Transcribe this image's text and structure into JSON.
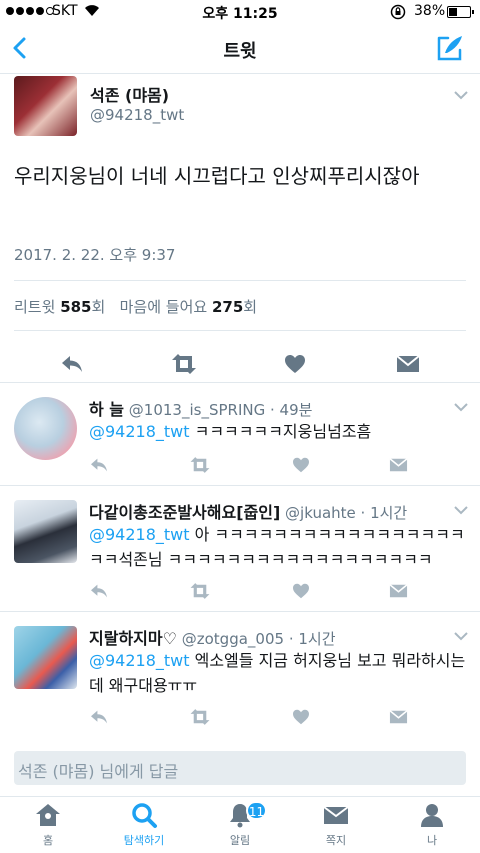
{
  "status": {
    "carrier": "SKT",
    "time": "오후 11:25",
    "battery": "38%",
    "battery_level": 0.38
  },
  "nav": {
    "title": "트윗"
  },
  "tweet": {
    "name": "석존 (먀몸)",
    "handle": "@94218_twt",
    "text": "우리지웅님이 너네 시끄럽다고 인상찌푸리시잖아",
    "timestamp": "2017. 2. 22. 오후 9:37",
    "retweet_label": "리트윗",
    "retweet_count": "585",
    "retweet_unit": "회",
    "like_label": "마음에 들어요",
    "like_count": "275",
    "like_unit": "회"
  },
  "replies": [
    {
      "name": "하 늘",
      "handle": "@1013_is_SPRING",
      "time": "49분",
      "mention": "@94218_twt",
      "text": " ㅋㅋㅋㅋㅋㅋ지웅님넘조흠"
    },
    {
      "name": "다같이총조준발사해요[줍인]",
      "handle": "@jkuahte",
      "time": "1시간",
      "mention": "@94218_twt",
      "text": " 아 ㅋㅋㅋㅋㅋㅋㅋㅋㅋㅋㅋㅋㅋㅋㅋㅋㅋㅋㅋ석존님 ㅋㅋㅋㅋㅋㅋㅋㅋㅋㅋㅋㅋㅋㅋㅋㅋㅋㅋ"
    },
    {
      "name": "지랄하지마♡",
      "handle": "@zotgga_005",
      "time": "1시간",
      "mention": "@94218_twt",
      "text": " 엑소엘들 지금 허지웅님 보고 뭐라하시는데 왜구대용ㅠㅠ"
    }
  ],
  "reply_box": {
    "placeholder": "석존 (먀몸) 님에게 답글"
  },
  "tabs": [
    {
      "label": "홈",
      "icon": "home-icon"
    },
    {
      "label": "탐색하기",
      "icon": "search-icon"
    },
    {
      "label": "알림",
      "icon": "bell-icon",
      "badge": "11"
    },
    {
      "label": "쪽지",
      "icon": "envelope-icon"
    },
    {
      "label": "나",
      "icon": "person-icon"
    }
  ],
  "colors": {
    "accent": "#1da1f2",
    "muted": "#657786",
    "icon": "#657786",
    "icon_light": "#aab8c2"
  }
}
